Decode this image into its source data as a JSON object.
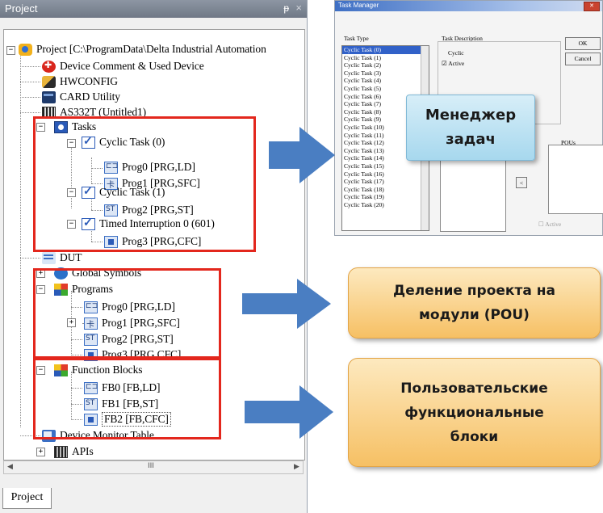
{
  "panel": {
    "title": "Project",
    "pin_glyph": "ᵽ",
    "close_glyph": "×",
    "bottom_tab": "Project",
    "scroll_grip": "III"
  },
  "tree": {
    "root": "Project [C:\\ProgramData\\Delta Industrial Automation",
    "device_comment": "Device Comment & Used Device",
    "hwconfig": "HWCONFIG",
    "card_utility": "CARD Utility",
    "plc": "AS332T  (Untitled1)",
    "tasks": "Tasks",
    "cyclic0": "Cyclic Task (0)",
    "cyclic0_prog0": "Prog0 [PRG,LD]",
    "cyclic0_prog1": "Prog1 [PRG,SFC]",
    "cyclic1": "Cyclic Task (1)",
    "cyclic1_prog2": "Prog2 [PRG,ST]",
    "timed": "Timed Interruption 0 (601)",
    "timed_prog3": "Prog3 [PRG,CFC]",
    "dut": "DUT",
    "global_symbols": "Global Symbols",
    "programs": "Programs",
    "programs_prog0": "Prog0 [PRG,LD]",
    "programs_prog1": "Prog1 [PRG,SFC]",
    "programs_prog2": "Prog2 [PRG,ST]",
    "programs_prog3": "Prog3 [PRG,CFC]",
    "function_blocks": "Function Blocks",
    "fb0": "FB0 [FB,LD]",
    "fb1": "FB1 [FB,ST]",
    "fb2": "FB2 [FB,CFC]",
    "device_monitor": "Device Monitor Table",
    "apis": "APIs"
  },
  "task_manager": {
    "title": "Task Manager",
    "task_type_label": "Task Type",
    "task_description_label": "Task Description",
    "cyclic_label": "Cyclic",
    "active_label": "Active",
    "ok": "OK",
    "cancel": "Cancel",
    "pous_label": "POUs",
    "active_bottom": "Active",
    "items": [
      "Cyclic Task (0)",
      "Cyclic Task (1)",
      "Cyclic Task (2)",
      "Cyclic Task (3)",
      "Cyclic Task (4)",
      "Cyclic Task (5)",
      "Cyclic Task (6)",
      "Cyclic Task (7)",
      "Cyclic Task (8)",
      "Cyclic Task (9)",
      "Cyclic Task (10)",
      "Cyclic Task (11)",
      "Cyclic Task (12)",
      "Cyclic Task (13)",
      "Cyclic Task (14)",
      "Cyclic Task (15)",
      "Cyclic Task (16)",
      "Cyclic Task (17)",
      "Cyclic Task (18)",
      "Cyclic Task (19)",
      "Cyclic Task (20)"
    ]
  },
  "callouts": {
    "task_manager_l1": "Менеджер",
    "task_manager_l2": "задач",
    "pou_l1": "Деление проекта на",
    "pou_l2": "модули (POU)",
    "fb_l1": "Пользовательские",
    "fb_l2": "функциональные",
    "fb_l3": "блоки"
  },
  "colors": {
    "highlight_red": "#e3271d",
    "arrow_blue": "#4a7ec2",
    "callout_blue": "#a7d8ee",
    "callout_orange": "#f6c064",
    "selection_blue": "#3161c8"
  }
}
